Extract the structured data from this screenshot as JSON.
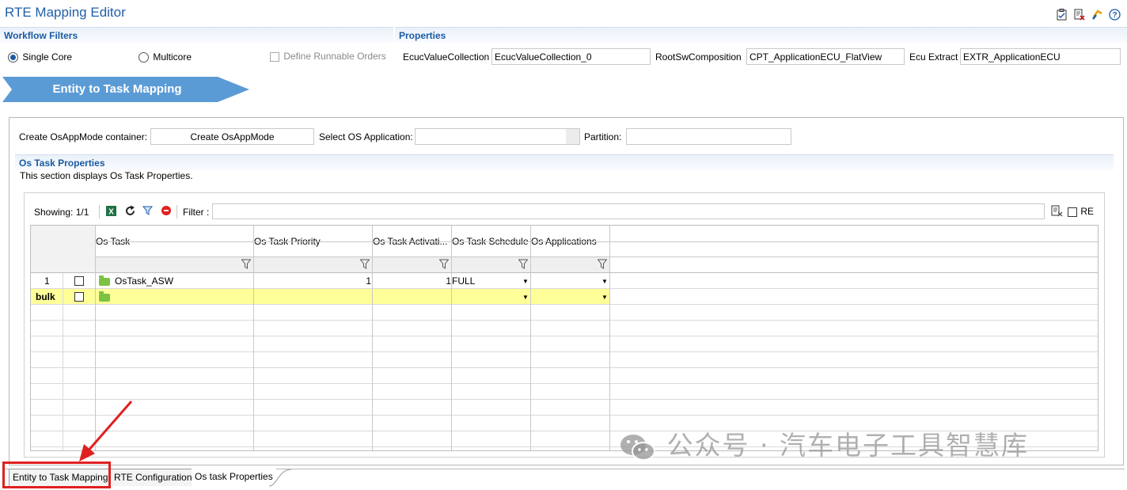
{
  "editor": {
    "title": "RTE Mapping Editor"
  },
  "toolbar_icons": [
    "clipboard-check-icon",
    "document-delete-icon",
    "sync-arrows-icon",
    "help-icon"
  ],
  "workflow_filters": {
    "header": "Workflow Filters",
    "single_core": "Single Core",
    "multicore": "Multicore",
    "define_runnable_orders": "Define Runnable Orders",
    "selected": "Single Core"
  },
  "properties": {
    "header": "Properties",
    "ecuc_label": "EcucValueCollection",
    "ecuc_value": "EcucValueCollection_0",
    "root_label": "RootSwComposition",
    "root_value": "CPT_ApplicationECU_FlatView",
    "extract_label": "Ecu Extract",
    "extract_value": "EXTR_ApplicationECU"
  },
  "workflow_step": "Entity to Task Mapping",
  "osapp": {
    "create_label": "Create OsAppMode container:",
    "create_button": "Create OsAppMode",
    "select_label": "Select OS Application:",
    "select_value": "",
    "partition_label": "Partition:",
    "partition_value": ""
  },
  "os_task_props": {
    "header": "Os Task Properties",
    "description": "This section displays Os Task Properties."
  },
  "table_toolbar": {
    "showing": "Showing: 1/1",
    "filter_label": "Filter :",
    "filter_value": "",
    "re_label": "RE"
  },
  "table": {
    "columns": [
      "Os Task",
      "Os Task Priority",
      "Os Task Activati...",
      "Os Task Schedule",
      "Os Applications"
    ],
    "rows": [
      {
        "num": "1",
        "task": "OsTask_ASW",
        "priority": "1",
        "activation": "1",
        "schedule": "FULL",
        "applications": ""
      }
    ],
    "bulk_label": "bulk"
  },
  "tabs": [
    "Entity to Task Mapping",
    "RTE Configuration",
    "Os task Properties"
  ],
  "active_tab": "Os task Properties",
  "watermark": "公众号 · 汽车电子工具智慧库",
  "colors": {
    "accent": "#1a5aa3",
    "banner": "#5b9bd5",
    "bulk_row": "#ffff99",
    "highlight": "#e02020"
  }
}
